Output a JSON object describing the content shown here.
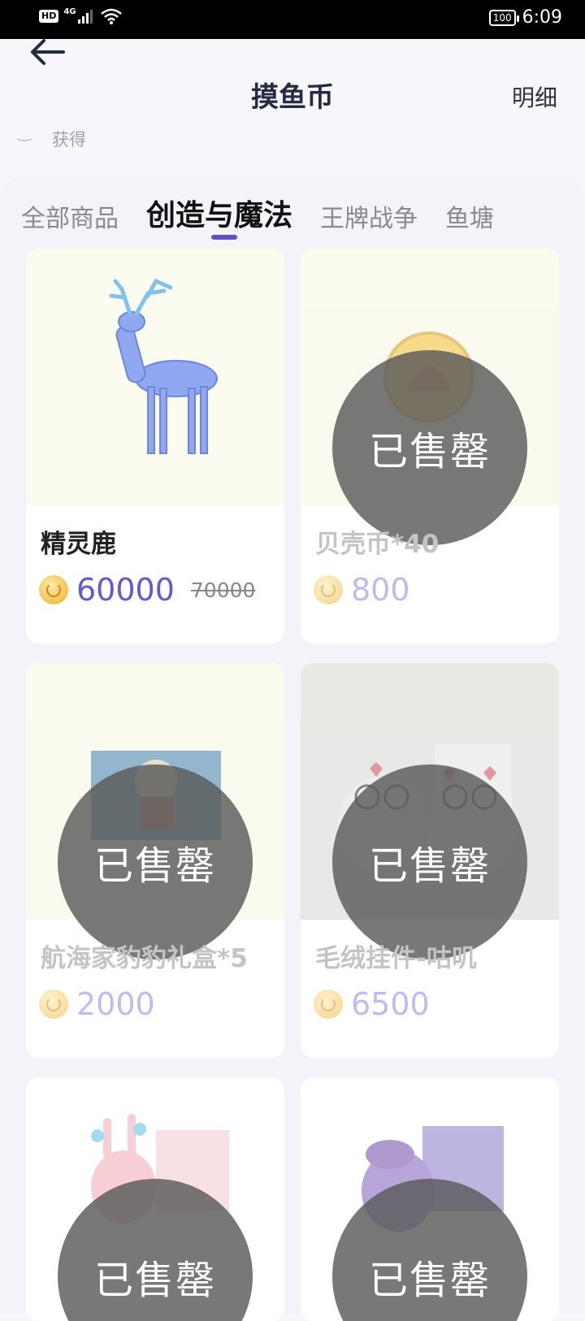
{
  "status_bar": {
    "hd": "HD",
    "network": "4G",
    "battery": "100",
    "time": "6:09"
  },
  "nav": {
    "title": "摸鱼币",
    "detail": "明细",
    "back_icon": "arrow-left-icon"
  },
  "sub_hint": "获得",
  "tabs": [
    {
      "label": "全部商品",
      "active": false
    },
    {
      "label": "创造与魔法",
      "active": true
    },
    {
      "label": "王牌战争",
      "active": false
    },
    {
      "label": "鱼塘",
      "active": false
    }
  ],
  "products": [
    {
      "name": "精灵鹿",
      "price": "60000",
      "original_price": "70000",
      "sold_out": false,
      "image": "spirit-deer"
    },
    {
      "name": "贝壳币*40",
      "price": "800",
      "sold_out": true,
      "image": "shell-coin"
    },
    {
      "name": "航海家豹豹礼盒*5",
      "price": "2000",
      "sold_out": true,
      "image": "navigator-gift-box"
    },
    {
      "name": "毛绒挂件-咕叽",
      "price": "6500",
      "sold_out": true,
      "image": "plush-owl-pendant"
    },
    {
      "name": "",
      "price": "",
      "sold_out": true,
      "image": "pink-bunny-plush"
    },
    {
      "name": "",
      "price": "",
      "sold_out": true,
      "image": "purple-dragon-plush"
    }
  ],
  "sold_out_label": "已售罄",
  "colors": {
    "accent": "#5a4fcf",
    "price": "#6a55d8",
    "background": "#f6f6fb"
  }
}
